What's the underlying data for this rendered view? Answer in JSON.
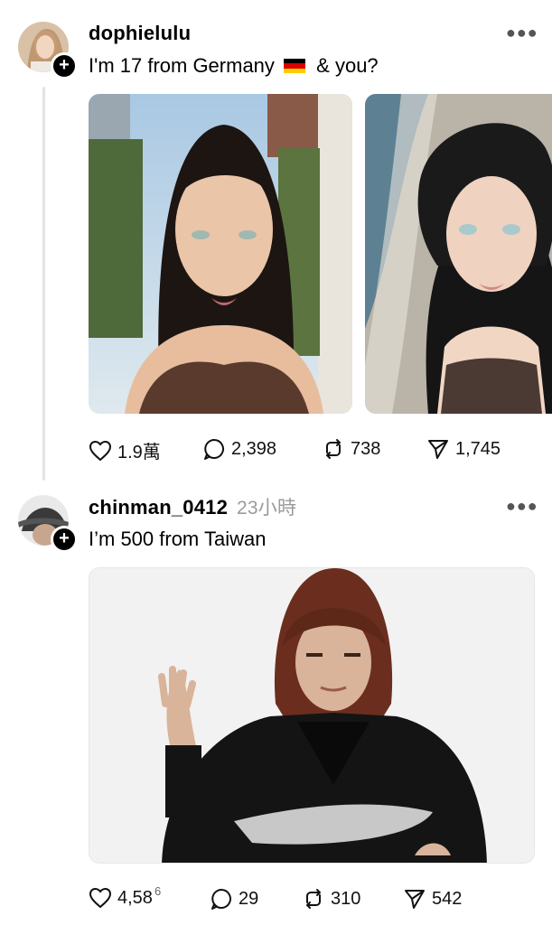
{
  "posts": [
    {
      "username": "dophielulu",
      "time": "",
      "text_before_flag": "I'm 17 from Germany",
      "text_after_flag": "& you?",
      "flag_colors": [
        "#000000",
        "#dd0000",
        "#ffce00"
      ],
      "actions": {
        "likes": "1.9萬",
        "comments": "2,398",
        "reposts": "738",
        "shares": "1,745"
      }
    },
    {
      "username": "chinman_0412",
      "time": "23小時",
      "text": "I’m 500 from Taiwan",
      "actions": {
        "likes": "4,58",
        "likes_overlay": "6",
        "comments": "29",
        "reposts": "310",
        "shares": "542"
      }
    }
  ],
  "colors": {
    "text": "#000000",
    "muted": "#9a9a9a",
    "thread_line": "#e3e3e3"
  },
  "icons": [
    "more-icon",
    "heart-icon",
    "comment-icon",
    "repost-icon",
    "share-icon",
    "follow-plus-icon"
  ]
}
